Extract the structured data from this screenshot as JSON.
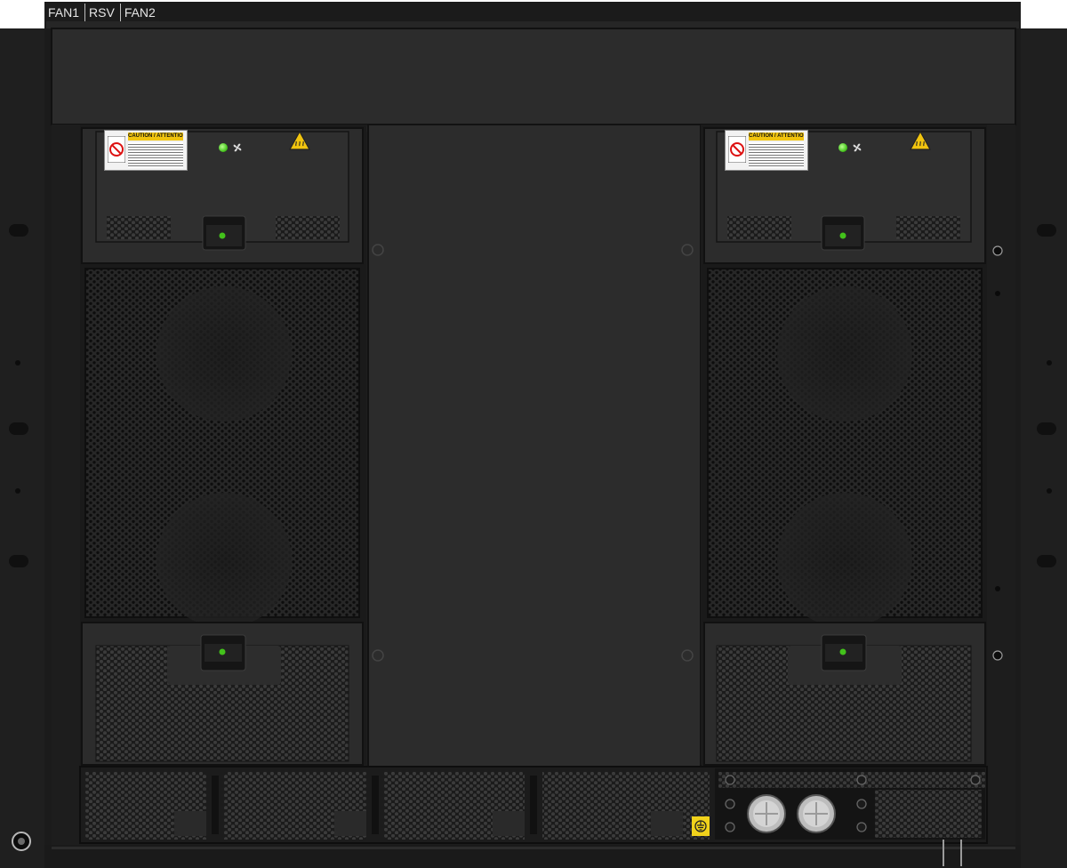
{
  "slot_labels": [
    "FAN1",
    "RSV",
    "FAN2"
  ],
  "caution_label": {
    "title": "CAUTION / ATTENTION"
  },
  "icons": [
    "no-touch-icon",
    "fan-icon",
    "hot-surface-warning-icon",
    "ground-icon",
    "status-led"
  ],
  "colors": {
    "chassis": "#1e1e1e",
    "panel": "#2b2b2b",
    "led": "#43c21b",
    "caution": "#f1c40f",
    "ground_label": "#f1d21b"
  }
}
